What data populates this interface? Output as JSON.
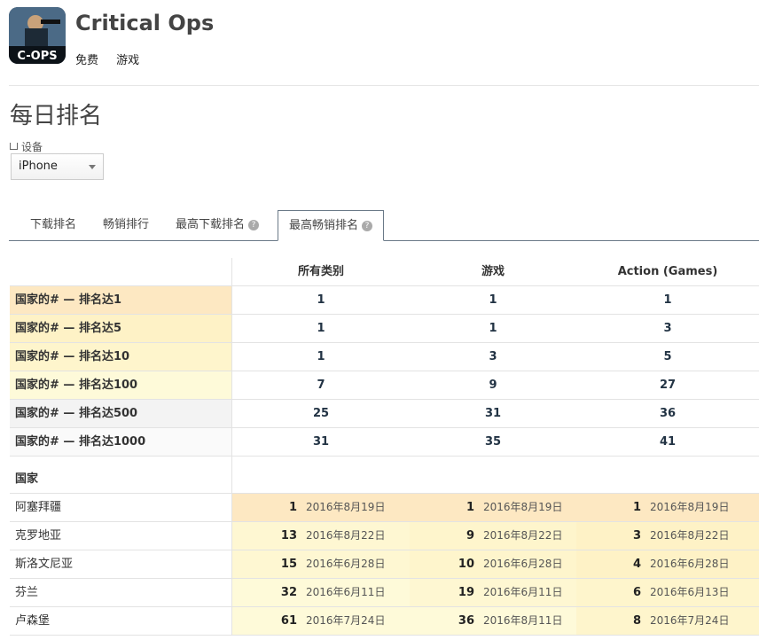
{
  "app": {
    "title": "Critical Ops",
    "icon_text": "C-OPS",
    "price": "免费",
    "category": "游戏"
  },
  "section_title": "每日排名",
  "device": {
    "label": "设备",
    "selected": "iPhone"
  },
  "tabs": [
    {
      "label": "下载排名",
      "help": false
    },
    {
      "label": "畅销排行",
      "help": false
    },
    {
      "label": "最高下载排名",
      "help": true
    },
    {
      "label": "最高畅销排名",
      "help": true,
      "active": true
    }
  ],
  "summary": {
    "columns": [
      "所有类别",
      "游戏",
      "Action (Games)"
    ],
    "rows": [
      {
        "label": "国家的# — 排名达1",
        "values": [
          "1",
          "1",
          "1"
        ],
        "color": "#fde8c2"
      },
      {
        "label": "国家的# — 排名达5",
        "values": [
          "1",
          "1",
          "3"
        ],
        "color": "#fef2c6"
      },
      {
        "label": "国家的# — 排名达10",
        "values": [
          "1",
          "3",
          "5"
        ],
        "color": "#fef5cc"
      },
      {
        "label": "国家的# — 排名达100",
        "values": [
          "7",
          "9",
          "27"
        ],
        "color": "#fefad9"
      },
      {
        "label": "国家的# — 排名达500",
        "values": [
          "25",
          "31",
          "36"
        ],
        "color": "#f3f3f3"
      },
      {
        "label": "国家的# — 排名达1000",
        "values": [
          "31",
          "35",
          "41"
        ],
        "color": "#fafafa"
      }
    ]
  },
  "countries": {
    "header": "国家",
    "rows": [
      {
        "name": "阿塞拜疆",
        "cells": [
          {
            "rank": "1",
            "date": "2016年8月19日",
            "color": "#fde8c2"
          },
          {
            "rank": "1",
            "date": "2016年8月19日",
            "color": "#fde8c2"
          },
          {
            "rank": "1",
            "date": "2016年8月19日",
            "color": "#fde8c2"
          }
        ]
      },
      {
        "name": "克罗地亚",
        "cells": [
          {
            "rank": "13",
            "date": "2016年8月22日",
            "color": "#fef7d2"
          },
          {
            "rank": "9",
            "date": "2016年8月22日",
            "color": "#fef5cc"
          },
          {
            "rank": "3",
            "date": "2016年8月22日",
            "color": "#fef2c6"
          }
        ]
      },
      {
        "name": "斯洛文尼亚",
        "cells": [
          {
            "rank": "15",
            "date": "2016年6月28日",
            "color": "#fef7d2"
          },
          {
            "rank": "10",
            "date": "2016年6月28日",
            "color": "#fef5cc"
          },
          {
            "rank": "4",
            "date": "2016年6月28日",
            "color": "#fef2c6"
          }
        ]
      },
      {
        "name": "芬兰",
        "cells": [
          {
            "rank": "32",
            "date": "2016年6月11日",
            "color": "#fefad9"
          },
          {
            "rank": "19",
            "date": "2016年6月11日",
            "color": "#fef7d2"
          },
          {
            "rank": "6",
            "date": "2016年6月13日",
            "color": "#fef5cc"
          }
        ]
      },
      {
        "name": "卢森堡",
        "cells": [
          {
            "rank": "61",
            "date": "2016年7月24日",
            "color": "#fefad9"
          },
          {
            "rank": "36",
            "date": "2016年8月11日",
            "color": "#fefad9"
          },
          {
            "rank": "8",
            "date": "2016年7月24日",
            "color": "#fef5cc"
          }
        ]
      }
    ]
  }
}
